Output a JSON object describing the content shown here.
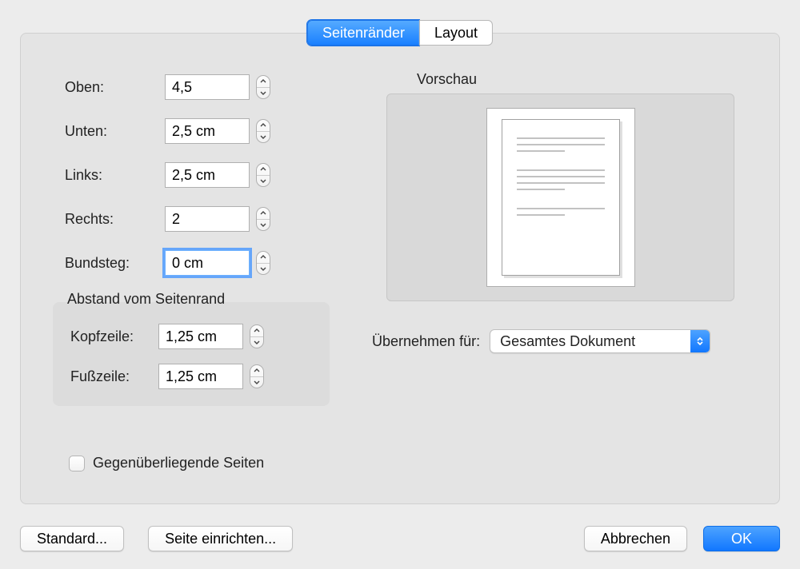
{
  "tabs": {
    "margins": "Seitenränder",
    "layout": "Layout"
  },
  "margins": {
    "top_label": "Oben:",
    "top_value": "4,5",
    "bottom_label": "Unten:",
    "bottom_value": "2,5 cm",
    "left_label": "Links:",
    "left_value": "2,5 cm",
    "right_label": "Rechts:",
    "right_value": "2",
    "gutter_label": "Bundsteg:",
    "gutter_value": "0 cm"
  },
  "edge_distance": {
    "legend": "Abstand vom Seitenrand",
    "header_label": "Kopfzeile:",
    "header_value": "1,25 cm",
    "footer_label": "Fußzeile:",
    "footer_value": "1,25 cm"
  },
  "mirror": {
    "label": "Gegenüberliegende Seiten",
    "checked": false
  },
  "preview": {
    "label": "Vorschau"
  },
  "apply_to": {
    "label": "Übernehmen für:",
    "value": "Gesamtes Dokument"
  },
  "buttons": {
    "default": "Standard...",
    "page_setup": "Seite einrichten...",
    "cancel": "Abbrechen",
    "ok": "OK"
  }
}
